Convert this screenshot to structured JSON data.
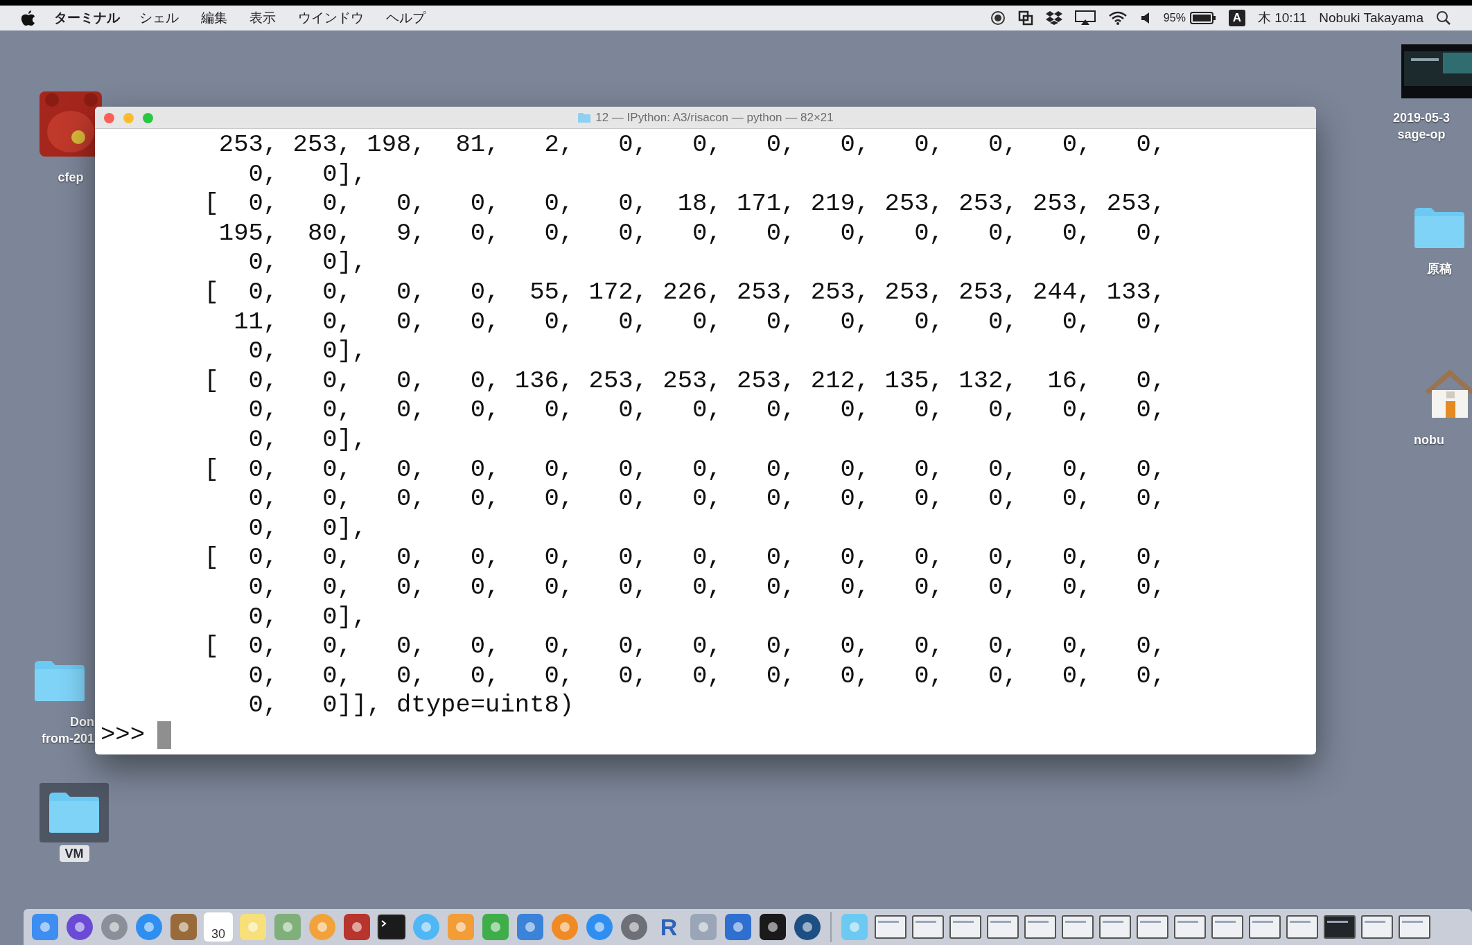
{
  "menu_bar": {
    "app_name": "ターミナル",
    "menus": [
      "シェル",
      "編集",
      "表示",
      "ウインドウ",
      "ヘルプ"
    ],
    "battery_percent": "95%",
    "input_mode": "A",
    "clock": "木 10:11",
    "user": "Nobuki Takayama"
  },
  "desktop_icons": [
    {
      "kind": "app",
      "labels": [
        "cfep"
      ],
      "selected": false
    },
    {
      "kind": "folder",
      "labels": [
        "Don",
        "from-201"
      ],
      "selected": false
    },
    {
      "kind": "folder",
      "labels": [
        "VM"
      ],
      "selected": true
    },
    {
      "kind": "screenshot",
      "labels": [
        "2019-05-3",
        "sage-op"
      ],
      "selected": false
    },
    {
      "kind": "folder",
      "labels": [
        "原稿"
      ],
      "selected": false
    },
    {
      "kind": "home",
      "labels": [
        "nobu"
      ],
      "selected": false
    }
  ],
  "terminal": {
    "title": "12 — IPython: A3/risacon — python — 82×21",
    "lines": [
      "        253, 253, 198,  81,   2,   0,   0,   0,   0,   0,   0,   0,   0,",
      "          0,   0],",
      "       [  0,   0,   0,   0,   0,   0,  18, 171, 219, 253, 253, 253, 253,",
      "        195,  80,   9,   0,   0,   0,   0,   0,   0,   0,   0,   0,   0,",
      "          0,   0],",
      "       [  0,   0,   0,   0,  55, 172, 226, 253, 253, 253, 253, 244, 133,",
      "         11,   0,   0,   0,   0,   0,   0,   0,   0,   0,   0,   0,   0,",
      "          0,   0],",
      "       [  0,   0,   0,   0, 136, 253, 253, 253, 212, 135, 132,  16,   0,",
      "          0,   0,   0,   0,   0,   0,   0,   0,   0,   0,   0,   0,   0,",
      "          0,   0],",
      "       [  0,   0,   0,   0,   0,   0,   0,   0,   0,   0,   0,   0,   0,",
      "          0,   0,   0,   0,   0,   0,   0,   0,   0,   0,   0,   0,   0,",
      "          0,   0],",
      "       [  0,   0,   0,   0,   0,   0,   0,   0,   0,   0,   0,   0,   0,",
      "          0,   0,   0,   0,   0,   0,   0,   0,   0,   0,   0,   0,   0,",
      "          0,   0],",
      "       [  0,   0,   0,   0,   0,   0,   0,   0,   0,   0,   0,   0,   0,",
      "          0,   0,   0,   0,   0,   0,   0,   0,   0,   0,   0,   0,   0,",
      "          0,   0]], dtype=uint8)"
    ],
    "prompt": ">>>"
  },
  "dock": {
    "calendar_day": "30",
    "r_letter": "R",
    "items": [
      {
        "kind": "finder"
      },
      {
        "kind": "siri"
      },
      {
        "kind": "launchpad"
      },
      {
        "kind": "safari"
      },
      {
        "kind": "notebook"
      },
      {
        "kind": "calendar"
      },
      {
        "kind": "notes"
      },
      {
        "kind": "preview"
      },
      {
        "kind": "photos"
      },
      {
        "kind": "redapp"
      },
      {
        "kind": "terminal"
      },
      {
        "kind": "messages"
      },
      {
        "kind": "pages"
      },
      {
        "kind": "numbers"
      },
      {
        "kind": "keynote"
      },
      {
        "kind": "books"
      },
      {
        "kind": "appstore"
      },
      {
        "kind": "prefs"
      },
      {
        "kind": "r"
      },
      {
        "kind": "editor"
      },
      {
        "kind": "remote"
      },
      {
        "kind": "x11"
      },
      {
        "kind": "quicktime"
      },
      {
        "kind": "separator"
      },
      {
        "kind": "folderdoc"
      },
      {
        "kind": "window"
      },
      {
        "kind": "window"
      },
      {
        "kind": "window"
      },
      {
        "kind": "window"
      },
      {
        "kind": "window"
      },
      {
        "kind": "window"
      },
      {
        "kind": "window"
      },
      {
        "kind": "window"
      },
      {
        "kind": "window"
      },
      {
        "kind": "window"
      },
      {
        "kind": "window"
      },
      {
        "kind": "window"
      },
      {
        "kind": "darkwindow"
      },
      {
        "kind": "window"
      },
      {
        "kind": "window"
      }
    ]
  }
}
